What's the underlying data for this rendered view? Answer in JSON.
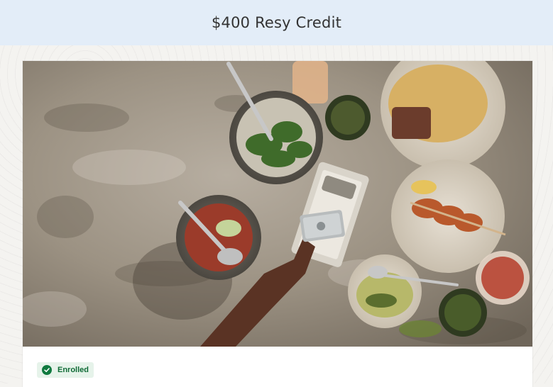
{
  "header": {
    "title": "$400 Resy Credit"
  },
  "hero": {
    "image_description_icon": "dining-table-photo"
  },
  "status": {
    "label": "Enrolled",
    "icon": "check-circle-icon",
    "color": "#0f7a3f"
  },
  "colors": {
    "header_bg": "#e3edf8",
    "badge_bg": "#e6f3ea"
  }
}
